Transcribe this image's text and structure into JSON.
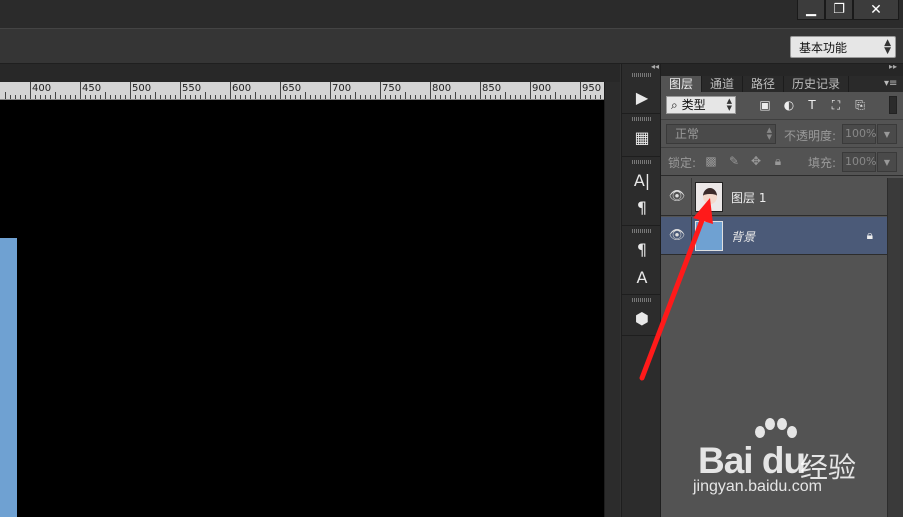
{
  "window": {
    "minimize_icon": "minimize-icon",
    "maximize_icon": "restore-icon",
    "close_icon": "close-icon",
    "minimize_glyph": "▁",
    "maximize_glyph": "❐",
    "close_glyph": "✕"
  },
  "options_bar": {
    "workspace": "基本功能"
  },
  "ruler": {
    "labels": [
      "400",
      "450",
      "500",
      "550",
      "600",
      "650",
      "700",
      "750",
      "800",
      "850",
      "900",
      "950"
    ]
  },
  "dock": {
    "icons": [
      {
        "name": "play-actions-icon",
        "glyph": "▶"
      },
      {
        "name": "properties-icon",
        "glyph": "▦"
      },
      {
        "name": "character-icon",
        "glyph": "A|"
      },
      {
        "name": "paragraph-icon",
        "glyph": "¶"
      },
      {
        "name": "paragraph-styles-icon",
        "glyph": "¶"
      },
      {
        "name": "character-styles-icon",
        "glyph": "A"
      },
      {
        "name": "3d-icon",
        "glyph": "⬢"
      }
    ]
  },
  "layers_panel": {
    "collapse_left": "◂◂",
    "collapse_right": "▸▸",
    "tabs": [
      "图层",
      "通道",
      "路径",
      "历史记录"
    ],
    "menu_glyph": "▾≡",
    "filter": {
      "kind_label": "类型",
      "search_glyph": "⌕",
      "icons": [
        {
          "name": "filter-pixel-icon",
          "glyph": "▣"
        },
        {
          "name": "filter-adjustment-icon",
          "glyph": "◐"
        },
        {
          "name": "filter-type-icon",
          "glyph": "T"
        },
        {
          "name": "filter-shape-icon",
          "glyph": "⛶"
        },
        {
          "name": "filter-smart-object-icon",
          "glyph": "⎘"
        }
      ]
    },
    "blend_mode": "正常",
    "opacity_label": "不透明度:",
    "opacity_value": "100%",
    "lock_label": "锁定:",
    "lock_icons": [
      {
        "name": "lock-transparent-icon",
        "glyph": "▩"
      },
      {
        "name": "lock-image-icon",
        "glyph": "✎"
      },
      {
        "name": "lock-position-icon",
        "glyph": "✥"
      },
      {
        "name": "lock-all-icon",
        "glyph": "🔒︎"
      }
    ],
    "fill_label": "填充:",
    "fill_value": "100%",
    "layers": [
      {
        "name": "图层 1",
        "visible": true,
        "selected": false,
        "locked": false
      },
      {
        "name": "背景",
        "visible": true,
        "selected": true,
        "locked": true
      }
    ],
    "eye_glyph": "👁︎",
    "lock_glyph": "🔒︎"
  },
  "watermark": {
    "logo": "Bai du",
    "cn": "经验",
    "url": "jingyan.baidu.com"
  },
  "colors": {
    "canvas": "#000000",
    "canvas_strip": "#6fa1d2",
    "selected_layer": "#4b5a78",
    "arrow": "#ff1a1a"
  }
}
